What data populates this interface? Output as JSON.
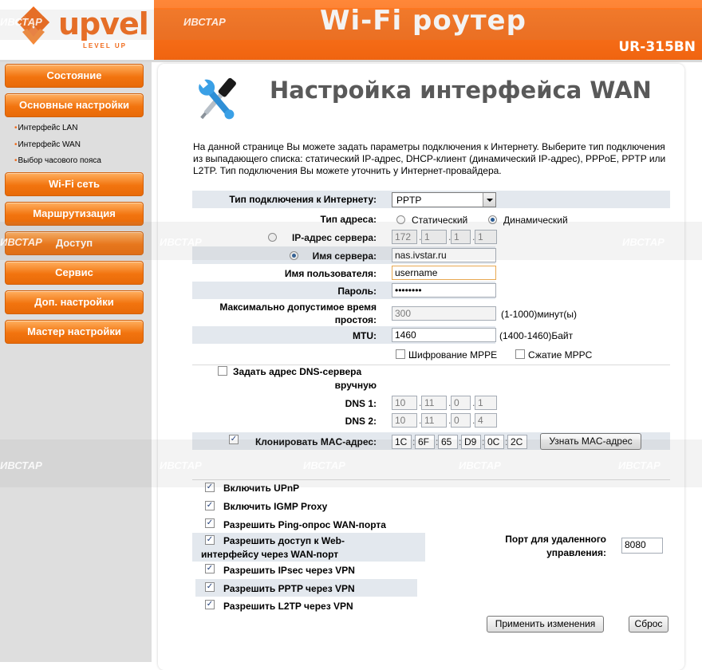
{
  "header": {
    "brand": "upvel",
    "brand_tagline": "LEVEL UP",
    "title": "Wi-Fi роутер",
    "model": "UR-315BN"
  },
  "sidebar": {
    "items": [
      {
        "label": "Состояние"
      },
      {
        "label": "Основные настройки"
      },
      {
        "label": "Wi-Fi сеть"
      },
      {
        "label": "Маршрутизация"
      },
      {
        "label": "Доступ"
      },
      {
        "label": "Сервис"
      },
      {
        "label": "Доп. настройки"
      },
      {
        "label": "Мастер настройки"
      }
    ],
    "submenu": [
      "Интерфейс LAN",
      "Интерфейс WAN",
      "Выбор часового пояса"
    ]
  },
  "page": {
    "title": "Настройка интерфейса WAN",
    "icon": "tools-icon",
    "description": "На данной странице Вы можете задать параметры подключения к Интернету. Выберите тип подключения из выпадающего списка: статический IP-адрес, DHCP-клиент (динамический IP-адрес), PPPoE, PPTP или L2TP. Тип подключения Вы можете уточнить у Интернет-провайдера."
  },
  "form": {
    "connection_type_label": "Тип подключения к Интернету:",
    "connection_type_value": "PPTP",
    "address_type_label": "Тип адреса:",
    "static_label": "Статический",
    "dynamic_label": "Динамический",
    "server_ip_label": "IP-адрес сервера:",
    "server_ip": [
      "172",
      "1",
      "1",
      "1"
    ],
    "server_name_label": "Имя сервера:",
    "server_name_value": "nas.ivstar.ru",
    "username_label": "Имя пользователя:",
    "username_value": "username",
    "password_label": "Пароль:",
    "password_value": "••••••••",
    "idle_label_1": "Максимально допустимое время",
    "idle_label_2": "простоя:",
    "idle_value": "300",
    "idle_hint": "(1-1000)минут(ы)",
    "mtu_label": "MTU:",
    "mtu_value": "1460",
    "mtu_hint": "(1400-1460)Байт",
    "mppe_label": "Шифрование MPPE",
    "mppc_label": "Сжатие MPPC",
    "dns_manual_label_1": "Задать адрес DNS-сервера",
    "dns_manual_label_2": "вручную",
    "dns1_label": "DNS 1:",
    "dns1": [
      "10",
      "11",
      "0",
      "1"
    ],
    "dns2_label": "DNS 2:",
    "dns2": [
      "10",
      "11",
      "0",
      "4"
    ],
    "clone_mac_label": "Клонировать MAC-адрес:",
    "mac": [
      "1C",
      "6F",
      "65",
      "D9",
      "0C",
      "2C"
    ],
    "mac_button": "Узнать MAC-адрес",
    "upnp_label": "Включить UPnP",
    "igmp_label": "Включить IGMP Proxy",
    "ping_label": "Разрешить Ping-опрос WAN-порта",
    "web_access_label_1": "Разрешить доступ к Web-",
    "web_access_label_2": "интерфейсу через WAN-порт",
    "remote_port_label_1": "Порт для удаленного",
    "remote_port_label_2": "управления:",
    "remote_port_value": "8080",
    "ipsec_label": "Разрешить IPsec через VPN",
    "pptp_label": "Разрешить PPTP через VPN",
    "l2tp_label": "Разрешить L2TP через VPN",
    "apply_button": "Применить изменения",
    "reset_button": "Сброс"
  },
  "watermark": "ИВСТАР",
  "colors": {
    "brand_orange": "#f06a1a",
    "row_highlight": "#e3e8ee",
    "sidebar_bg": "#dedede"
  }
}
